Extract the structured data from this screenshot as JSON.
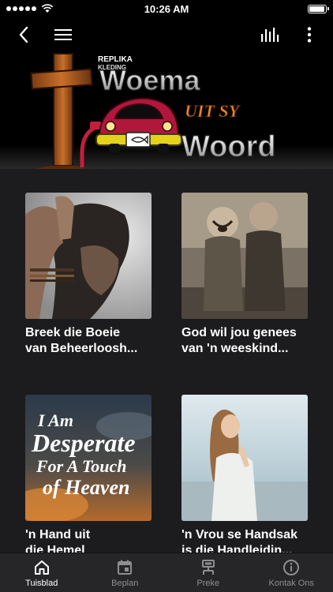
{
  "status_bar": {
    "time": "10:26 AM",
    "battery_level": 0.95
  },
  "app_bar": {
    "back_icon": "chevron-left-icon",
    "menu_icon": "hamburger-icon",
    "player_icon": "equalizer-icon",
    "more_icon": "more-vertical-icon"
  },
  "banner": {
    "badge": "REPLIKA",
    "badge2": "KLEDING",
    "line1": "Woema",
    "line2": "UIT SY",
    "line3": "Woord"
  },
  "cards": [
    {
      "title_line1": "Breek die Boeie",
      "title_line2": "van Beheerloosh..."
    },
    {
      "title_line1": "God wil jou genees",
      "title_line2": "van 'n weeskind..."
    },
    {
      "title_line1": "'n Hand uit",
      "title_line2": "die Hemel"
    },
    {
      "title_line1": "'n Vrou se Handsak",
      "title_line2": "is die Handleidin..."
    }
  ],
  "poster": {
    "line1": "I Am",
    "line2": "Desperate",
    "line3": "For A Touch",
    "line4": "of Heaven"
  },
  "tabs": [
    {
      "label": "Tuisblad",
      "icon": "home-icon",
      "active": true
    },
    {
      "label": "Beplan",
      "icon": "calendar-icon",
      "active": false
    },
    {
      "label": "Preke",
      "icon": "sermon-icon",
      "active": false
    },
    {
      "label": "Kontak Ons",
      "icon": "info-icon",
      "active": false
    }
  ],
  "colors": {
    "background": "#1c1c1e",
    "bar": "#000000",
    "tabbar": "#262628",
    "active": "#ffffff",
    "inactive": "#8e8e93"
  }
}
